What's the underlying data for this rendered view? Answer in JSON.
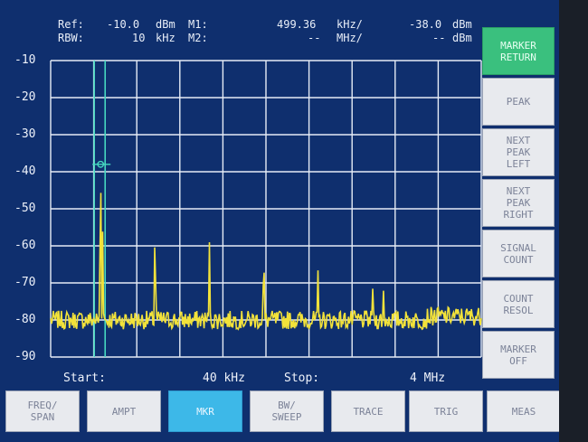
{
  "header": {
    "ref_label": "Ref:",
    "ref_value": "-10.0",
    "ref_unit": "dBm",
    "rbw_label": "RBW:",
    "rbw_value": "10",
    "rbw_unit": "kHz",
    "m1_label": "M1:",
    "m1_freq": "499.36",
    "m1_freq_unit": "kHz/",
    "m1_level": "-38.0",
    "m1_level_unit": "dBm",
    "m2_label": "M2:",
    "m2_freq": "--",
    "m2_freq_unit": "MHz/",
    "m2_level": "--",
    "m2_level_unit": "dBm"
  },
  "axis": {
    "y_ticks": [
      "-10",
      "-20",
      "-30",
      "-40",
      "-50",
      "-60",
      "-70",
      "-80",
      "-90"
    ]
  },
  "footer": {
    "start_label": "Start:",
    "start_value": "40 kHz",
    "stop_label": "Stop:",
    "stop_value": "4 MHz"
  },
  "softkeys": [
    {
      "label": "MARKER\nRETURN",
      "active": true
    },
    {
      "label": "PEAK",
      "active": false
    },
    {
      "label": "NEXT\nPEAK\nLEFT",
      "active": false
    },
    {
      "label": "NEXT\nPEAK\nRIGHT",
      "active": false
    },
    {
      "label": "SIGNAL\nCOUNT",
      "active": false
    },
    {
      "label": "COUNT\nRESOL",
      "active": false
    },
    {
      "label": "MARKER\nOFF",
      "active": false
    }
  ],
  "menu": [
    {
      "label": "FREQ/\nSPAN",
      "active": false
    },
    {
      "label": "AMPT",
      "active": false
    },
    {
      "label": "MKR",
      "active": true
    },
    {
      "label": "BW/\nSWEEP",
      "active": false
    },
    {
      "label": "TRACE",
      "active": false
    },
    {
      "label": "TRIG",
      "active": false
    },
    {
      "label": "MEAS",
      "active": false
    }
  ],
  "colors": {
    "screen_bg": "#0f2f6e",
    "grid": "#e6ecf6",
    "trace": "#f2e23a",
    "marker": "#46d8c0",
    "softkey_active": "#3ac07e",
    "menu_active": "#3db8e8"
  },
  "chart_data": {
    "type": "line",
    "xlim_khz": [
      40,
      4000
    ],
    "ylim_dbm": [
      -90,
      -10
    ],
    "marker_khz": 499.36,
    "marker_dbm": -38.0,
    "peaks": [
      {
        "x_khz": 499,
        "y_dbm": -38
      },
      {
        "x_khz": 520,
        "y_dbm": -55
      },
      {
        "x_khz": 1000,
        "y_dbm": -56
      },
      {
        "x_khz": 1500,
        "y_dbm": -59
      },
      {
        "x_khz": 2000,
        "y_dbm": -63
      },
      {
        "x_khz": 2500,
        "y_dbm": -66
      },
      {
        "x_khz": 3000,
        "y_dbm": -71
      },
      {
        "x_khz": 3100,
        "y_dbm": -72
      }
    ],
    "noise_floor_dbm": -80
  }
}
